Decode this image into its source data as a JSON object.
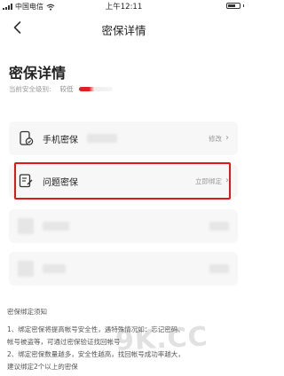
{
  "status_bar": {
    "carrier": "中国电信",
    "time": "上午12:11"
  },
  "header": {
    "title": "密保详情",
    "back_icon": "chevron-left-icon"
  },
  "page": {
    "title": "密保详情",
    "security_level_label": "当前安全级别:",
    "security_level_value": "较低",
    "security_level_fraction": 0.3,
    "security_level_color": "#e02020"
  },
  "cards": [
    {
      "label": "手机密保",
      "status": "修改",
      "icon": "phone-lock-icon"
    },
    {
      "label": "问题密保",
      "status": "立即绑定",
      "icon": "question-note-icon"
    },
    {
      "label": "",
      "status": "",
      "icon": "blurred"
    },
    {
      "label": "",
      "status": "",
      "icon": "blurred"
    }
  ],
  "highlight_color": "#e01818",
  "notice": {
    "title": "密保绑定须知",
    "lines": [
      "1、绑定密保将提高帐号安全性，遇特殊情况如：忘记密码、",
      "帐号被盗等，可通过密保验证找回帐号",
      "2、绑定密保数量越多，安全性越高，找回帐号成功率越大，",
      "建议绑定2个以上的密保"
    ]
  },
  "watermark": "9K.CC"
}
